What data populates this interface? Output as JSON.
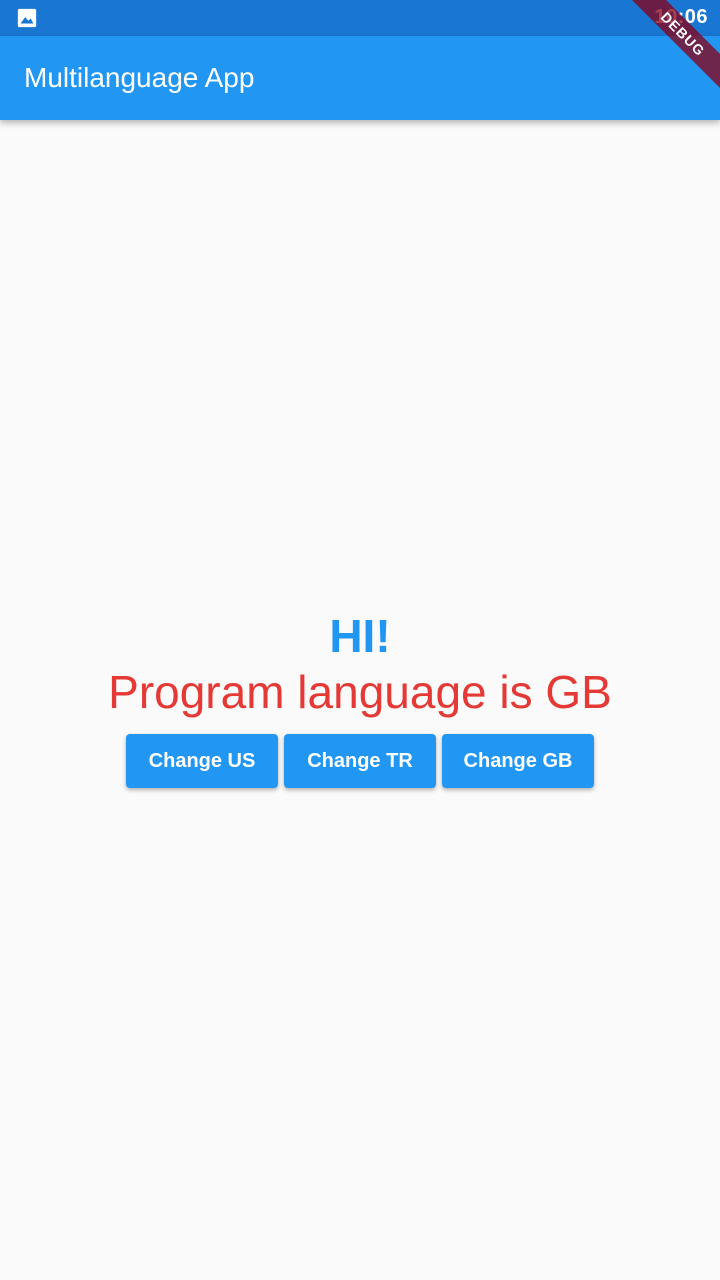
{
  "status_bar": {
    "time": "10:06",
    "notification_icon": "image-icon"
  },
  "app_bar": {
    "title": "Multilanguage App"
  },
  "debug_banner": {
    "label": "DEBUG"
  },
  "main": {
    "greeting": "HI!",
    "language_status": "Program language is GB",
    "buttons": [
      {
        "label": "Change US"
      },
      {
        "label": "Change TR"
      },
      {
        "label": "Change GB"
      }
    ]
  },
  "colors": {
    "status_bar": "#1976d2",
    "app_bar": "#2196f3",
    "greeting": "#2196f3",
    "language_status": "#e53935",
    "button": "#2196f3",
    "background": "#fafafa"
  }
}
